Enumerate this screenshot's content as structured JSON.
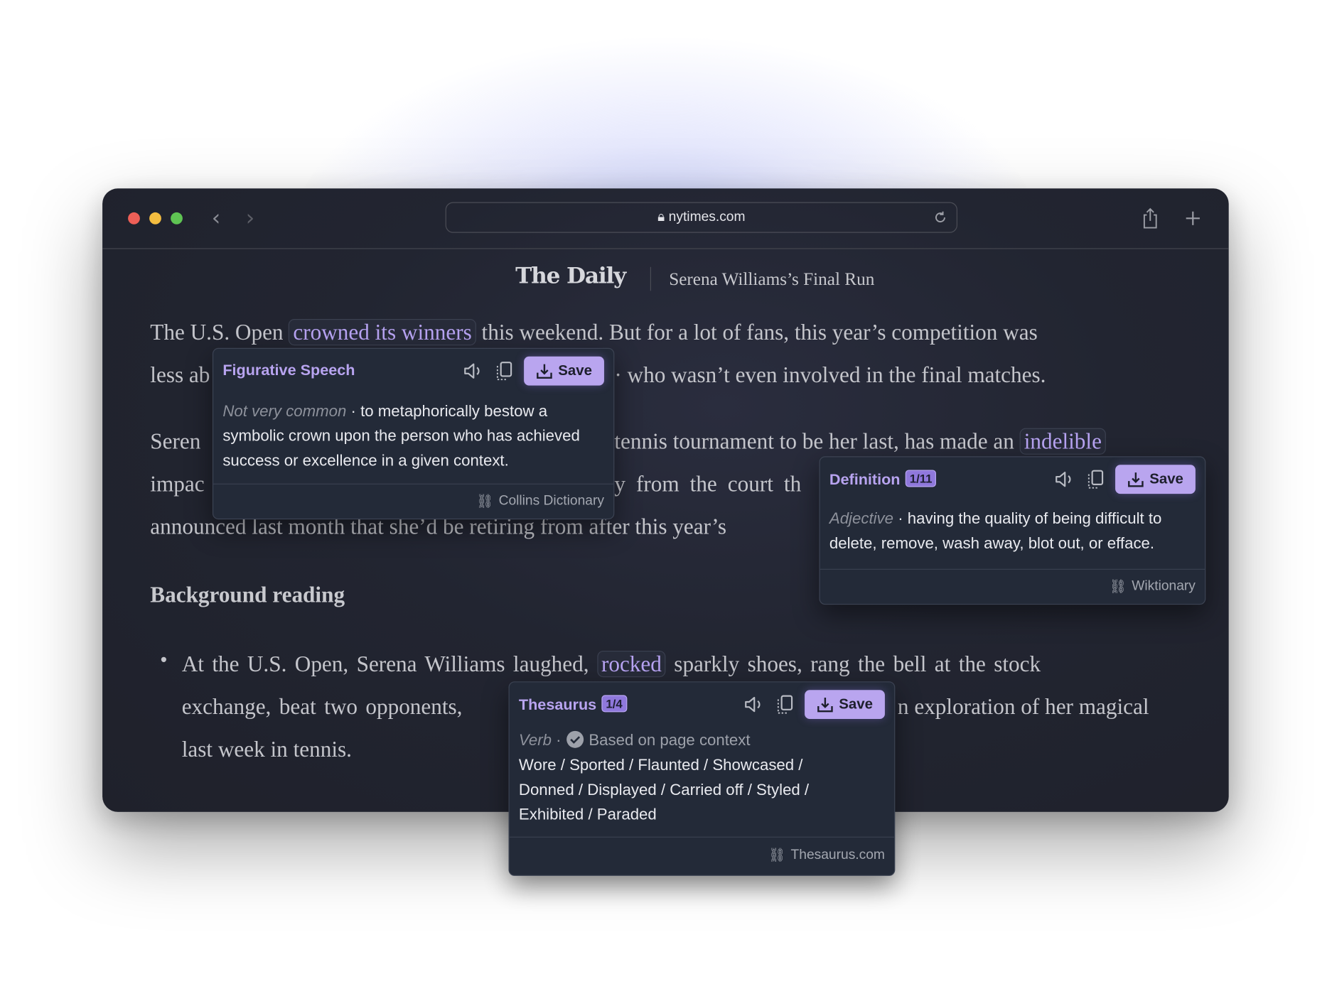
{
  "browser": {
    "url": "nytimes.com",
    "colors": {
      "close": "#ee5f57",
      "minimize": "#f4bd40",
      "maximize": "#5fc453"
    }
  },
  "masthead": {
    "logo": "The Daily",
    "episode": "Serena Williams’s Final Run"
  },
  "article": {
    "p1": {
      "l1a": "The U.S. Open",
      "l1hl": "crowned its winners",
      "l1b": "this weekend. But for a lot of fans, this year’s competition was",
      "l2a": "less ab",
      "l2b": "· who wasn’t even involved in the final matches."
    },
    "p2": {
      "l1a": "Seren",
      "l1b": "tennis tournament to be her last, has made an",
      "l1hl": "indelible",
      "l2a": "impac",
      "l2b": "y from the court th",
      "l3": "announced last month that she’d be retiring from after this year’s"
    },
    "heading": "Background reading",
    "bullet": {
      "l1a": "At the U.S. Open, Serena Williams laughed,",
      "l1hl": "rocked",
      "l1b": "sparkly shoes, rang the bell at the stock",
      "l2a": "exchange, beat two opponents,",
      "l2b": "n exploration of her magical",
      "l3": "last week in tennis."
    }
  },
  "popups": {
    "figurative": {
      "title": "Figurative Speech",
      "save": "Save",
      "label": "Not very common",
      "text": "· to metaphorically bestow a symbolic crown upon the person who has achieved success or excellence in a given context.",
      "source": "Collins Dictionary"
    },
    "definition": {
      "title": "Definition",
      "badge": "1/11",
      "save": "Save",
      "label": "Adjective",
      "text": "· having the quality of being difficult to delete, remove, wash away, blot out, or efface.",
      "source": "Wiktionary"
    },
    "thesaurus": {
      "title": "Thesaurus",
      "badge": "1/4",
      "save": "Save",
      "label": "Verb",
      "sep": "·",
      "context": "Based on page context",
      "text": "Wore / Sported / Flaunted / Showcased / Donned / Displayed / Carried off / Styled / Exhibited / Paraded",
      "source": "Thesaurus.com"
    }
  },
  "accent": "#b9a5ef"
}
